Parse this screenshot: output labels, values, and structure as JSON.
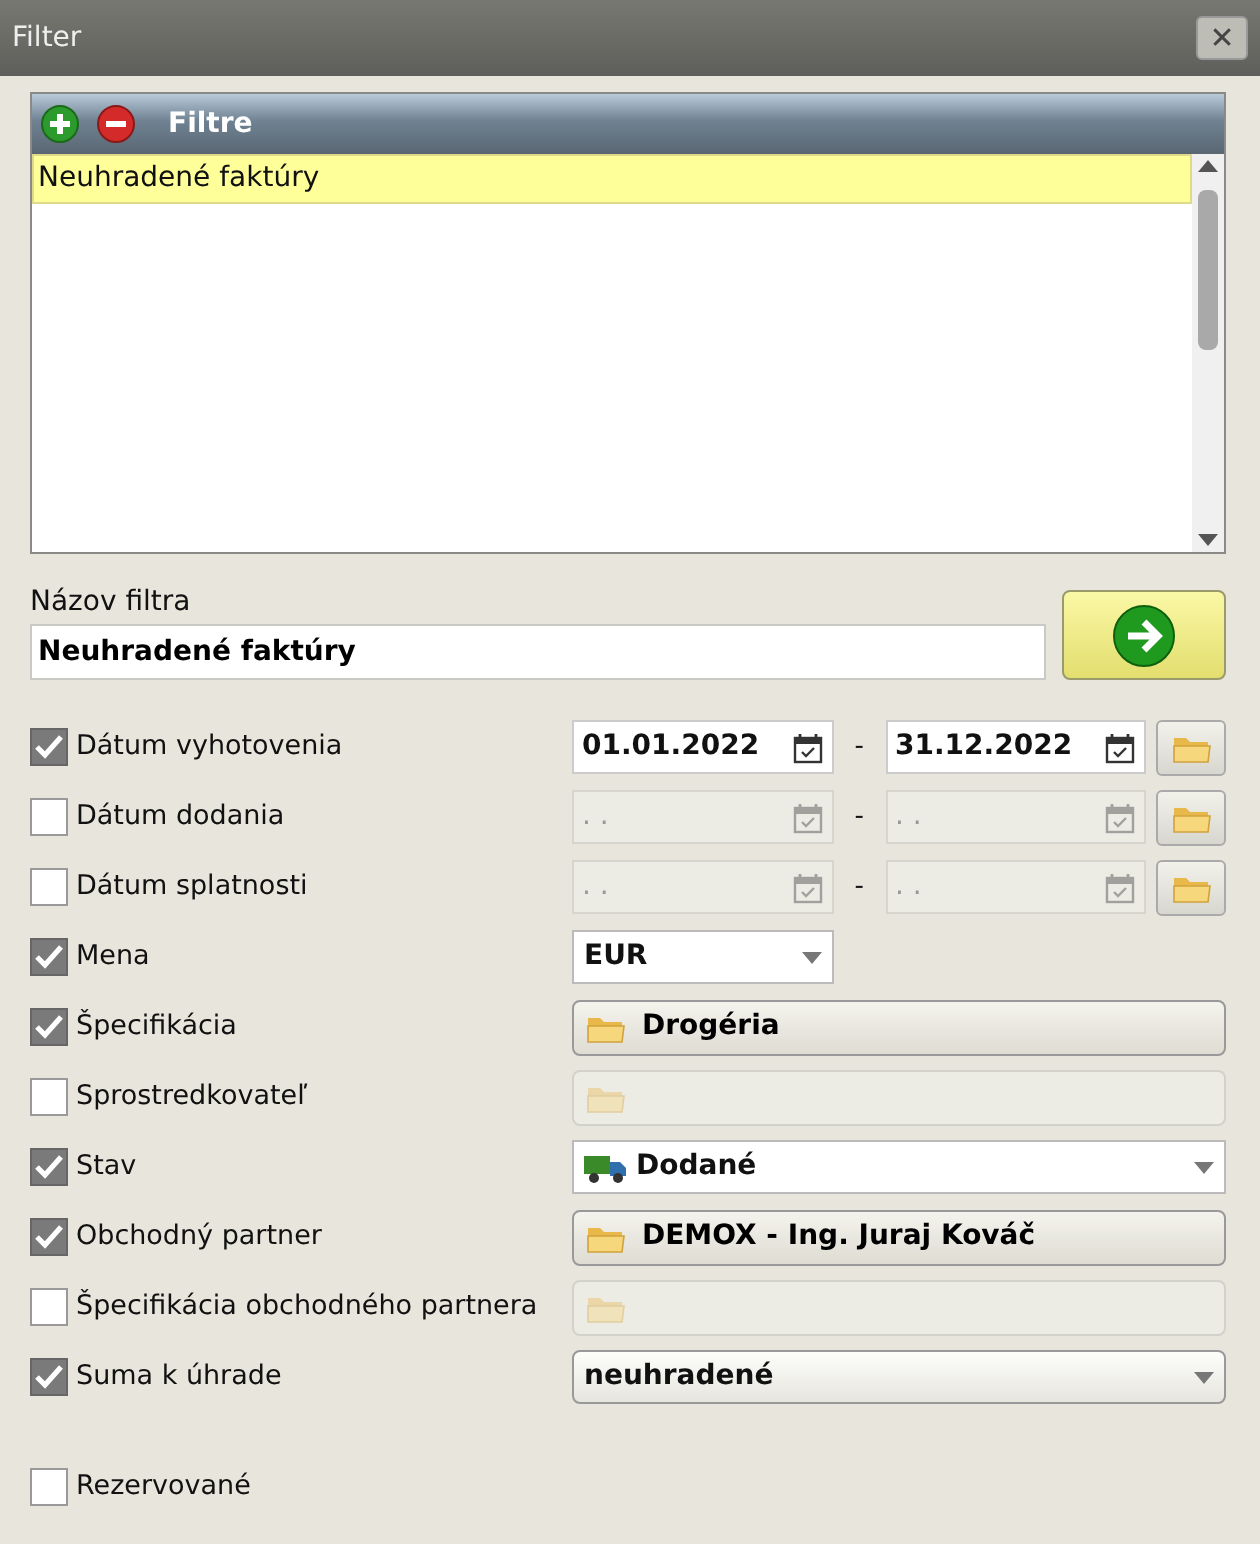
{
  "window": {
    "title": "Filter",
    "close": "✕"
  },
  "filters_panel": {
    "title": "Filtre",
    "items": [
      {
        "label": "Neuhradené faktúry",
        "selected": true
      }
    ]
  },
  "filter_name": {
    "label": "Názov filtra",
    "value": "Neuhradené faktúry"
  },
  "rows": [
    {
      "kind": "date_range",
      "label": "Dátum vyhotovenia",
      "checked": true,
      "from": "01.01.2022",
      "separator": "-",
      "to": "31.12.2022"
    },
    {
      "kind": "date_range",
      "label": "Dátum dodania",
      "checked": false,
      "from": ". .",
      "separator": "-",
      "to": ". ."
    },
    {
      "kind": "date_range",
      "label": "Dátum splatnosti",
      "checked": false,
      "from": ". .",
      "separator": "-",
      "to": ". ."
    },
    {
      "kind": "short_combo",
      "label": "Mena",
      "checked": true,
      "value": "EUR"
    },
    {
      "kind": "picker",
      "label": "Špecifikácia",
      "checked": true,
      "value": "Drogéria"
    },
    {
      "kind": "picker",
      "label": "Sprostredkovateľ",
      "checked": false
    },
    {
      "kind": "status_combo",
      "label": "Stav",
      "checked": true,
      "value": "Dodané"
    },
    {
      "kind": "picker",
      "label": "Obchodný partner",
      "checked": true,
      "value": "DEMOX - Ing. Juraj Kováč"
    },
    {
      "kind": "picker",
      "label": "Špecifikácia obchodného partnera",
      "checked": false
    },
    {
      "kind": "combo",
      "label": "Suma k úhrade",
      "checked": true,
      "value": "neuhradené"
    },
    {
      "kind": "check",
      "label": "Rezervované",
      "checked": false
    }
  ]
}
